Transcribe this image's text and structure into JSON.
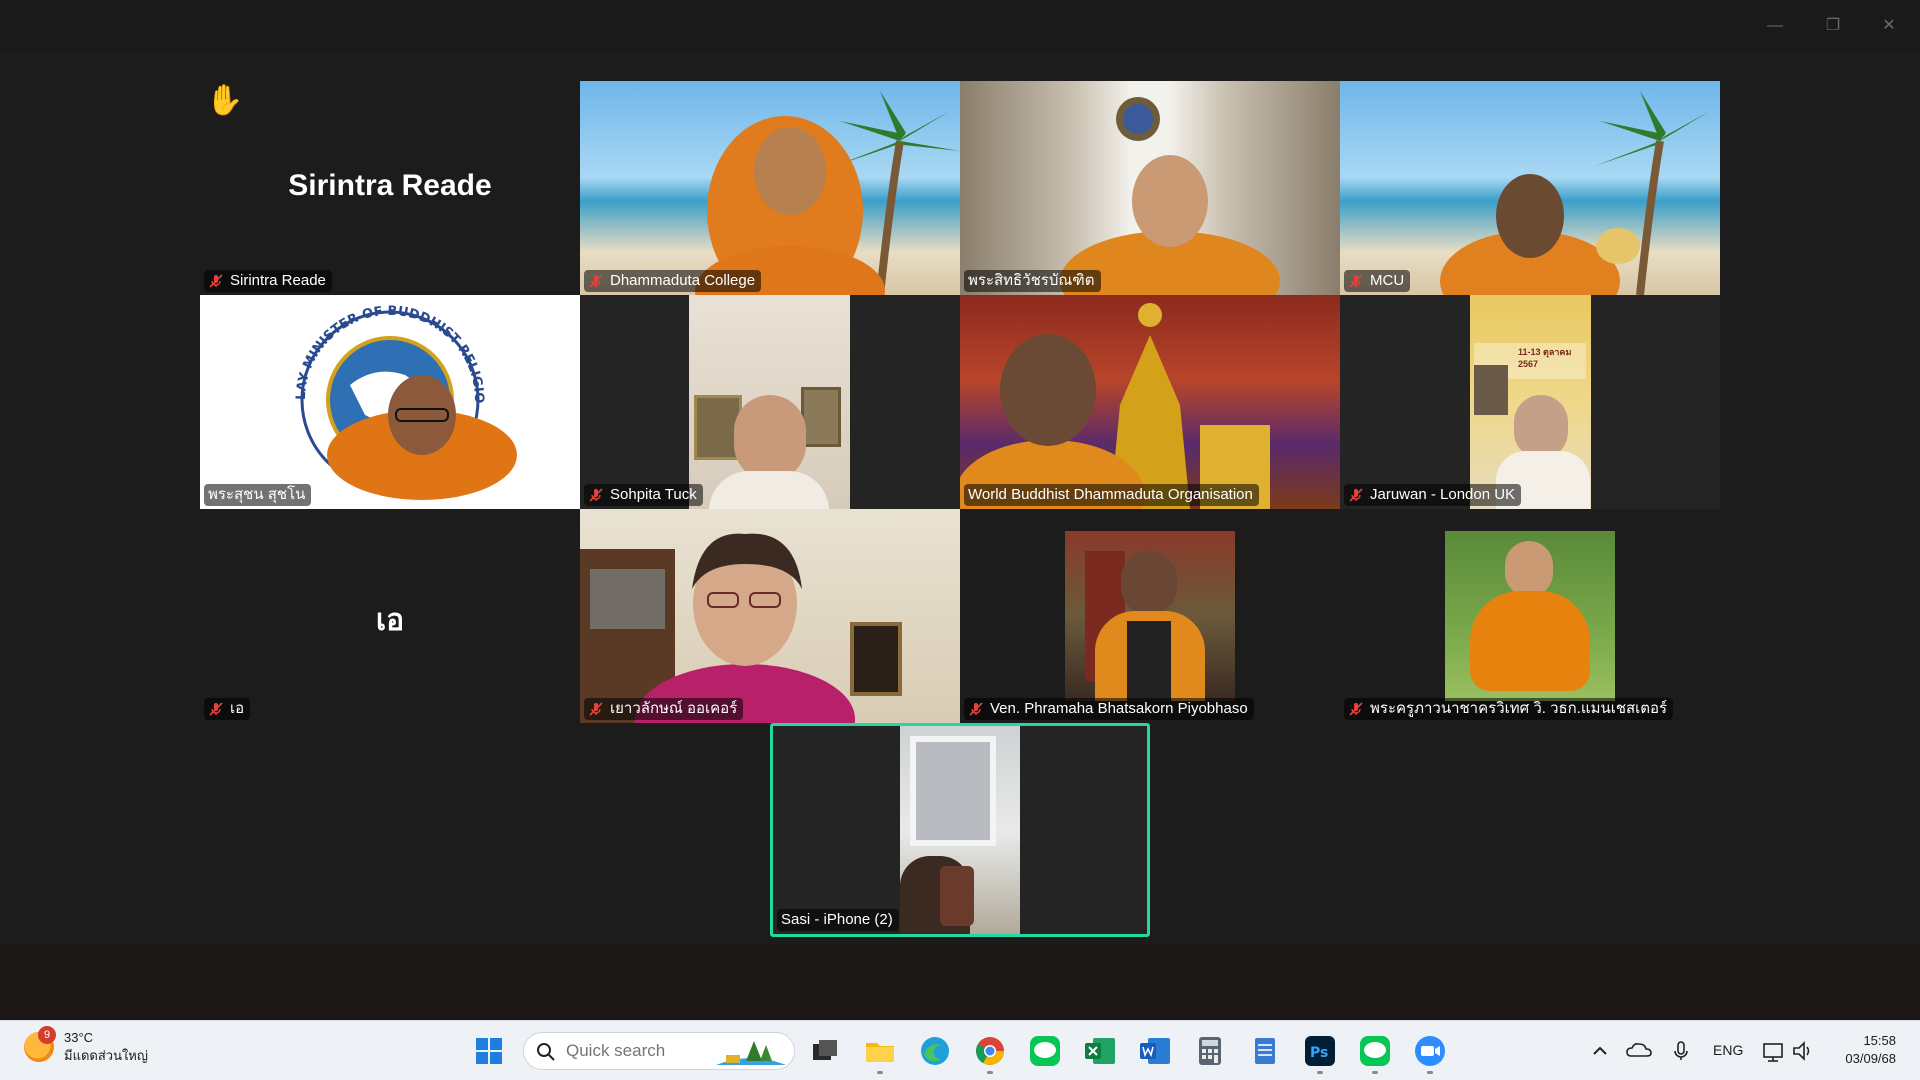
{
  "window": {
    "minimize": "—",
    "restore": "❐",
    "close": "✕"
  },
  "participants": {
    "sirintra": {
      "name": "Sirintra Reade",
      "display": "Sirintra Reade"
    },
    "dhammaduta": {
      "name": "Dhammaduta College"
    },
    "phrasit": {
      "name": "พระสิทธิวัชรบัณฑิต"
    },
    "mcu": {
      "name": "MCU"
    },
    "phrasuchon": {
      "name": "พระสุชน สุชโน"
    },
    "sohpita": {
      "name": "Sohpita Tuck"
    },
    "wbdo": {
      "name": "World Buddhist Dhammaduta Organisation"
    },
    "jaruwan": {
      "name": "Jaruwan - London UK"
    },
    "ae": {
      "name": "เอ",
      "display": "เอ"
    },
    "saowalak": {
      "name": "เยาวลักษณ์ ออเคอร์"
    },
    "phramaha": {
      "name": "Ven. Phramaha Bhatsakorn Piyobhaso"
    },
    "phrakru": {
      "name": "พระครูภาวนาชาครวิเทศ วิ. วธก.แมนเชสเตอร์"
    },
    "sasi": {
      "name": "Sasi - iPhone (2)"
    }
  },
  "logo_text": "LAY MINISTER OF BUDDHIST RELIGION",
  "poster": {
    "date": "11-13 ตุลาคม 2567"
  },
  "taskbar": {
    "weather_temp": "33°C",
    "weather_desc": "มีแดดส่วนใหญ่",
    "weather_badge": "9",
    "search_placeholder": "Quick search",
    "lang": "ENG",
    "time": "15:58",
    "date": "03/09/68"
  },
  "colors": {
    "active_speaker": "#23d9a0",
    "mute_red": "#e8413a"
  }
}
